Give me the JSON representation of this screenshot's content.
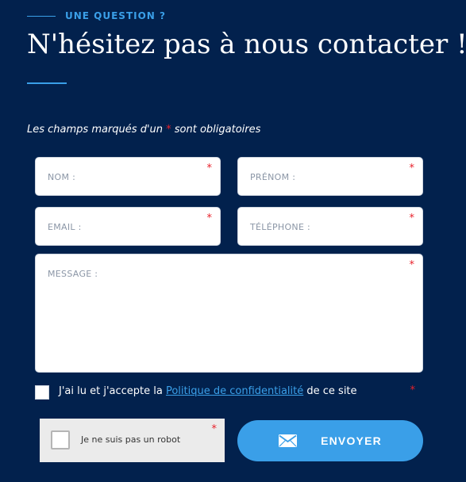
{
  "header": {
    "eyebrow": "UNE QUESTION ?",
    "title": "N'hésitez pas à nous contacter !"
  },
  "form": {
    "required_note_before": "Les champs marqués d'un ",
    "required_note_star": "*",
    "required_note_after": " sont obligatoires",
    "required_star": "*",
    "fields": {
      "nom": "NOM :",
      "prenom": "PRÉNOM :",
      "email": "EMAIL :",
      "telephone": "TÉLÉPHONE :",
      "message": "MESSAGE :"
    },
    "consent": {
      "before": "J'ai lu et j'accepte la ",
      "link": "Politique de confidentialité",
      "after": " de ce site"
    },
    "captcha_label": "Je ne suis pas un robot",
    "submit_label": "ENVOYER",
    "submit_icon": "envelope-icon"
  },
  "colors": {
    "background": "#02214d",
    "accent": "#3a9fe8",
    "required": "#e8202a"
  }
}
